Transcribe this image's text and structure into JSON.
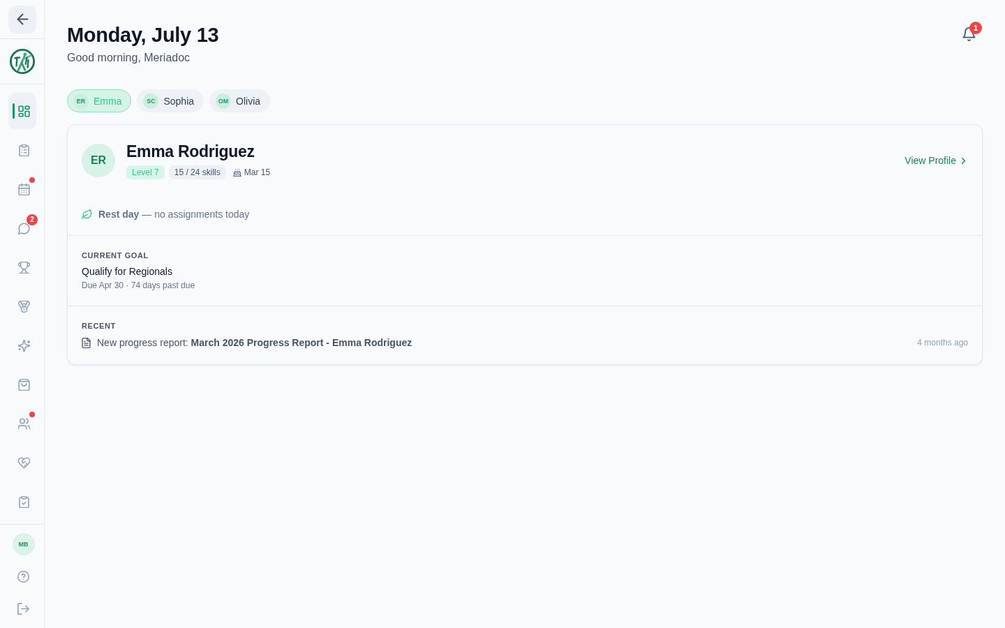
{
  "sidebar": {
    "nav": [
      {
        "selected": true,
        "dot": false
      },
      {
        "selected": false,
        "dot": false
      },
      {
        "selected": false,
        "dot": true
      },
      {
        "selected": false,
        "dot": false,
        "badge": "2"
      },
      {
        "selected": false,
        "dot": false
      },
      {
        "selected": false,
        "dot": false
      },
      {
        "selected": false,
        "dot": false
      },
      {
        "selected": false,
        "dot": false
      },
      {
        "selected": false,
        "dot": true
      },
      {
        "selected": false,
        "dot": false
      },
      {
        "selected": false,
        "dot": false
      }
    ],
    "user": {
      "initials": "MB"
    }
  },
  "header": {
    "title": "Monday, July 13",
    "greeting": "Good morning, Meriadoc",
    "notifications": {
      "count": "1"
    }
  },
  "athlete_tabs": [
    {
      "initials": "ER",
      "label": "Emma",
      "selected": true
    },
    {
      "initials": "SC",
      "label": "Sophia",
      "selected": false
    },
    {
      "initials": "OM",
      "label": "Olivia",
      "selected": false
    }
  ],
  "athlete_card": {
    "initials": "ER",
    "name": "Emma Rodriguez",
    "level": "Level 7",
    "skills": "15 / 24 skills",
    "birthday": "Mar 15",
    "view_profile": "View Profile",
    "today": "**Rest day** — no assignments today",
    "goal": {
      "label": "CURRENT GOAL",
      "title": "Qualify for Regionals",
      "meta": "Due Apr 30 · 74 days past due"
    },
    "recent": {
      "label": "RECENT",
      "text": "New progress report: **March 2026 Progress Report - Emma Rodriguez**",
      "time": "4 months ago"
    }
  }
}
